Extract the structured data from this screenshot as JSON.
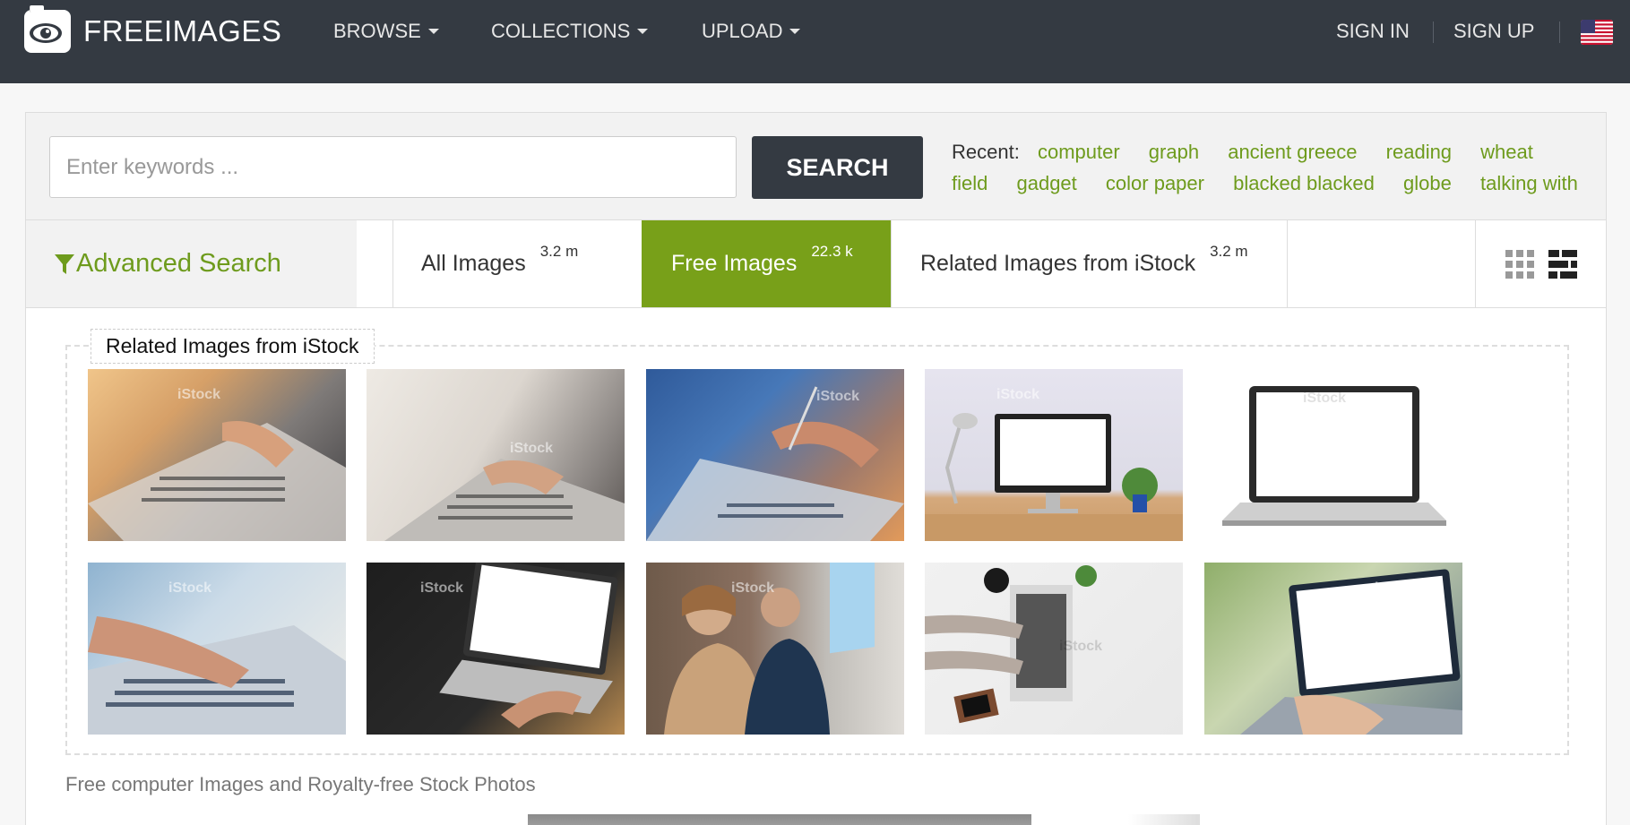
{
  "nav": {
    "logo_text": "FREEIMAGES",
    "browse": "BROWSE",
    "collections": "COLLECTIONS",
    "upload": "UPLOAD",
    "sign_in": "SIGN IN",
    "sign_up": "SIGN UP",
    "flag_icon": "us-flag-icon"
  },
  "search": {
    "placeholder": "Enter keywords ...",
    "value": "",
    "button": "SEARCH"
  },
  "recent": {
    "label": "Recent:",
    "items": [
      "computer",
      "graph",
      "ancient greece",
      "reading",
      "wheat",
      "field",
      "gadget",
      "color paper",
      "blacked blacked",
      "globe",
      "talking with"
    ]
  },
  "tabs": {
    "advanced": "Advanced Search",
    "items": [
      {
        "label": "All Images",
        "count": "3.2 m",
        "active": false
      },
      {
        "label": "Free Images",
        "count": "22.3 k",
        "active": true
      },
      {
        "label": "Related Images from iStock",
        "count": "3.2 m",
        "active": false
      }
    ]
  },
  "related": {
    "title": "Related Images from iStock",
    "watermark": "iStock",
    "thumbnails": [
      "typing-laptop-warm",
      "typing-laptop-white",
      "laptop-pen-blue",
      "desk-monitor-lamp",
      "laptop-white-screen",
      "typing-laptop-blue",
      "laptop-dark-desk",
      "people-monitor",
      "topdown-laptop",
      "laptop-outdoor"
    ]
  },
  "footer": {
    "text": "Free computer Images and Royalty-free Stock Photos"
  },
  "colors": {
    "nav_bg": "#343a42",
    "accent_green": "#78a019",
    "link_green": "#6e9b1d"
  }
}
